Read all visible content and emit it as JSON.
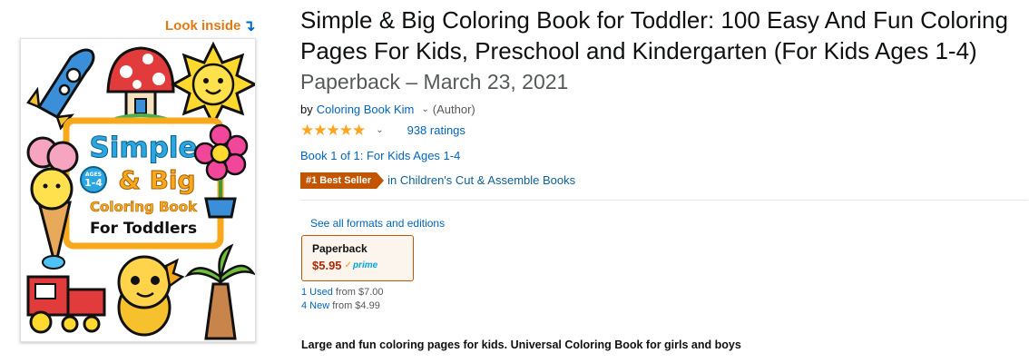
{
  "look_inside": {
    "label": "Look inside",
    "arrow": "↴"
  },
  "cover": {
    "line1": "Simple",
    "line2": "& Big",
    "age_top": "AGES",
    "age_range": "1-4",
    "line3": "Coloring Book",
    "line4": "For Toddlers"
  },
  "product": {
    "title": "Simple & Big Coloring Book for Toddler: 100 Easy And Fun Coloring Pages For Kids, Preschool and Kindergarten (For Kids Ages 1-4)",
    "binding": "Paperback – March 23, 2021",
    "by_prefix": "by",
    "author": "Coloring Book Kim",
    "author_role": "(Author)",
    "stars": "★★★★★",
    "rating_count": "938 ratings",
    "series": "Book 1 of 1: For Kids Ages 1-4",
    "bestseller_badge": "#1 Best Seller",
    "bestseller_category": "in Children's Cut & Assemble Books"
  },
  "formats": {
    "see_all": "See all formats and editions",
    "selected": {
      "name": "Paperback",
      "price": "$5.95",
      "prime_check": "✓",
      "prime_label": "prime"
    }
  },
  "offers": {
    "used_link": "1 Used",
    "used_from": "from $7.00",
    "new_link": "4 New",
    "new_from": "from $4.99"
  },
  "description": "Large and fun coloring pages for kids. Universal Coloring Book for girls and boys",
  "colors": {
    "accent": "#e47911",
    "link": "#0066c0",
    "badge": "#c45500",
    "price": "#b12704",
    "star": "#ffa41c"
  }
}
